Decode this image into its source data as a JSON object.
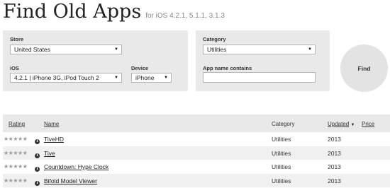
{
  "header": {
    "title": "Find Old Apps",
    "subtitle": "for iOS 4.2.1, 5.1.1, 3.1.3"
  },
  "filters": {
    "store_label": "Store",
    "store_value": "United States",
    "ios_label": "iOS",
    "ios_value": "4.2.1 | iPhone 3G, iPod Touch 2",
    "device_label": "Device",
    "device_value": "iPhone",
    "category_label": "Category",
    "category_value": "Utilities",
    "app_name_label": "App name contains",
    "app_name_value": ""
  },
  "find_button": "Find",
  "table": {
    "headers": {
      "rating": "Rating",
      "name": "Name",
      "category": "Category",
      "updated": "Updated",
      "price": "Price"
    },
    "sort_indicator": "▼",
    "rows": [
      {
        "rating": "★★★★★",
        "name": "TiveHD",
        "category": "Utilities",
        "updated": "2013",
        "price": ""
      },
      {
        "rating": "★★★★★",
        "name": "Tive",
        "category": "Utilities",
        "updated": "2013",
        "price": ""
      },
      {
        "rating": "★★★★★",
        "name": "Countdown: Hype Clock",
        "category": "Utilities",
        "updated": "2013",
        "price": ""
      },
      {
        "rating": "★★★★★",
        "name": "Bifold Model Viewer",
        "category": "Utilities",
        "updated": "2013",
        "price": ""
      }
    ]
  },
  "icons": {
    "info": "info-icon",
    "select_arrow": "chevron-down-icon",
    "rating": "star-rating-icon"
  },
  "colors": {
    "panel_bg": "#e9e9e9",
    "alt_row_bg": "#f0f0f0",
    "star_color": "#9a9a9a"
  }
}
